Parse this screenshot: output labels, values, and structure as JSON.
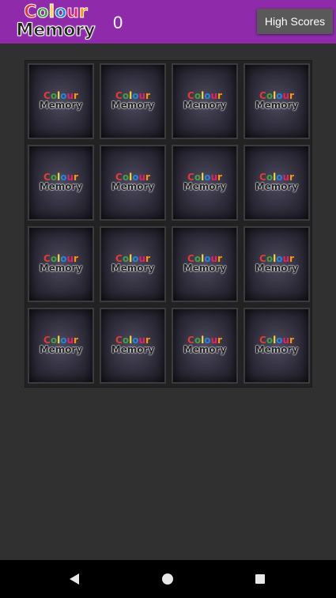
{
  "app": {
    "logo_line1": "Colour",
    "logo_line2": "Memory",
    "score": "0",
    "high_scores_label": "High Scores"
  },
  "colors": {
    "appbar": "#8f2bab",
    "logo_letters": [
      "#e53935",
      "#43a047",
      "#fdd835",
      "#1e88e5",
      "#e91e63",
      "#ff9800"
    ]
  },
  "board": {
    "rows": 4,
    "cols": 4,
    "card_face_text_line1": "Colour",
    "card_face_text_line2": "Memory",
    "cards_face_down": 16
  },
  "navigation": {
    "icons": [
      "back-icon",
      "home-icon",
      "recent-apps-icon"
    ]
  }
}
